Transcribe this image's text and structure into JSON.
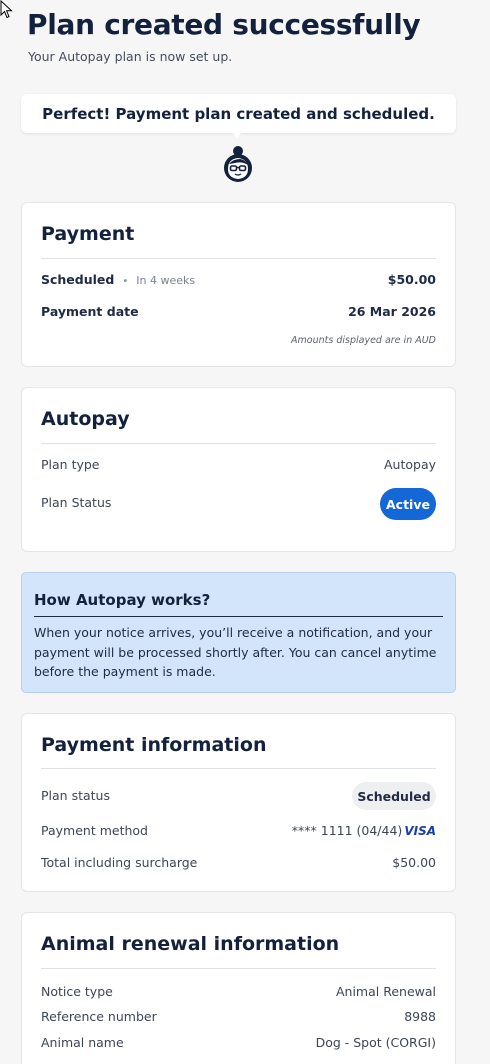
{
  "header": {
    "title": "Plan created successfully",
    "subtitle": "Your Autopay plan is now set up."
  },
  "banner": {
    "message": "Perfect! Payment plan created and scheduled."
  },
  "payment_card": {
    "title": "Payment",
    "scheduled_label": "Scheduled",
    "scheduled_separator": "•",
    "scheduled_when": "In 4 weeks",
    "scheduled_amount": "$50.00",
    "date_label": "Payment date",
    "date_value": "26 Mar 2026",
    "note": "Amounts displayed are in AUD"
  },
  "autopay_card": {
    "title": "Autopay",
    "plan_type_label": "Plan type",
    "plan_type_value": "Autopay",
    "plan_status_label": "Plan Status",
    "plan_status_value": "Active"
  },
  "how_it_works": {
    "title": "How Autopay works?",
    "body": "When your notice arrives, you’ll receive a notification, and your payment will be processed shortly after. You can cancel anytime before the payment is made."
  },
  "payment_info_card": {
    "title": "Payment information",
    "plan_status_label": "Plan status",
    "plan_status_value": "Scheduled",
    "method_label": "Payment method",
    "method_value": "**** 1111 (04/44)",
    "card_brand": "VISA",
    "total_label": "Total including surcharge",
    "total_value": "$50.00"
  },
  "animal_card": {
    "title": "Animal renewal information",
    "rows": [
      {
        "label": "Notice type",
        "value": "Animal Renewal"
      },
      {
        "label": "Reference number",
        "value": "8988"
      },
      {
        "label": "Animal name",
        "value": "Dog - Spot (CORGI)"
      }
    ]
  },
  "colors": {
    "accent": "#1467d6",
    "info_background": "#d3e5fb",
    "heading": "#13213d",
    "page_background": "#f6f6f6"
  },
  "icons": {
    "cursor": "arrow-cursor-icon",
    "avatar": "assistant-avatar-icon",
    "card_brand": "visa-logo-icon"
  }
}
